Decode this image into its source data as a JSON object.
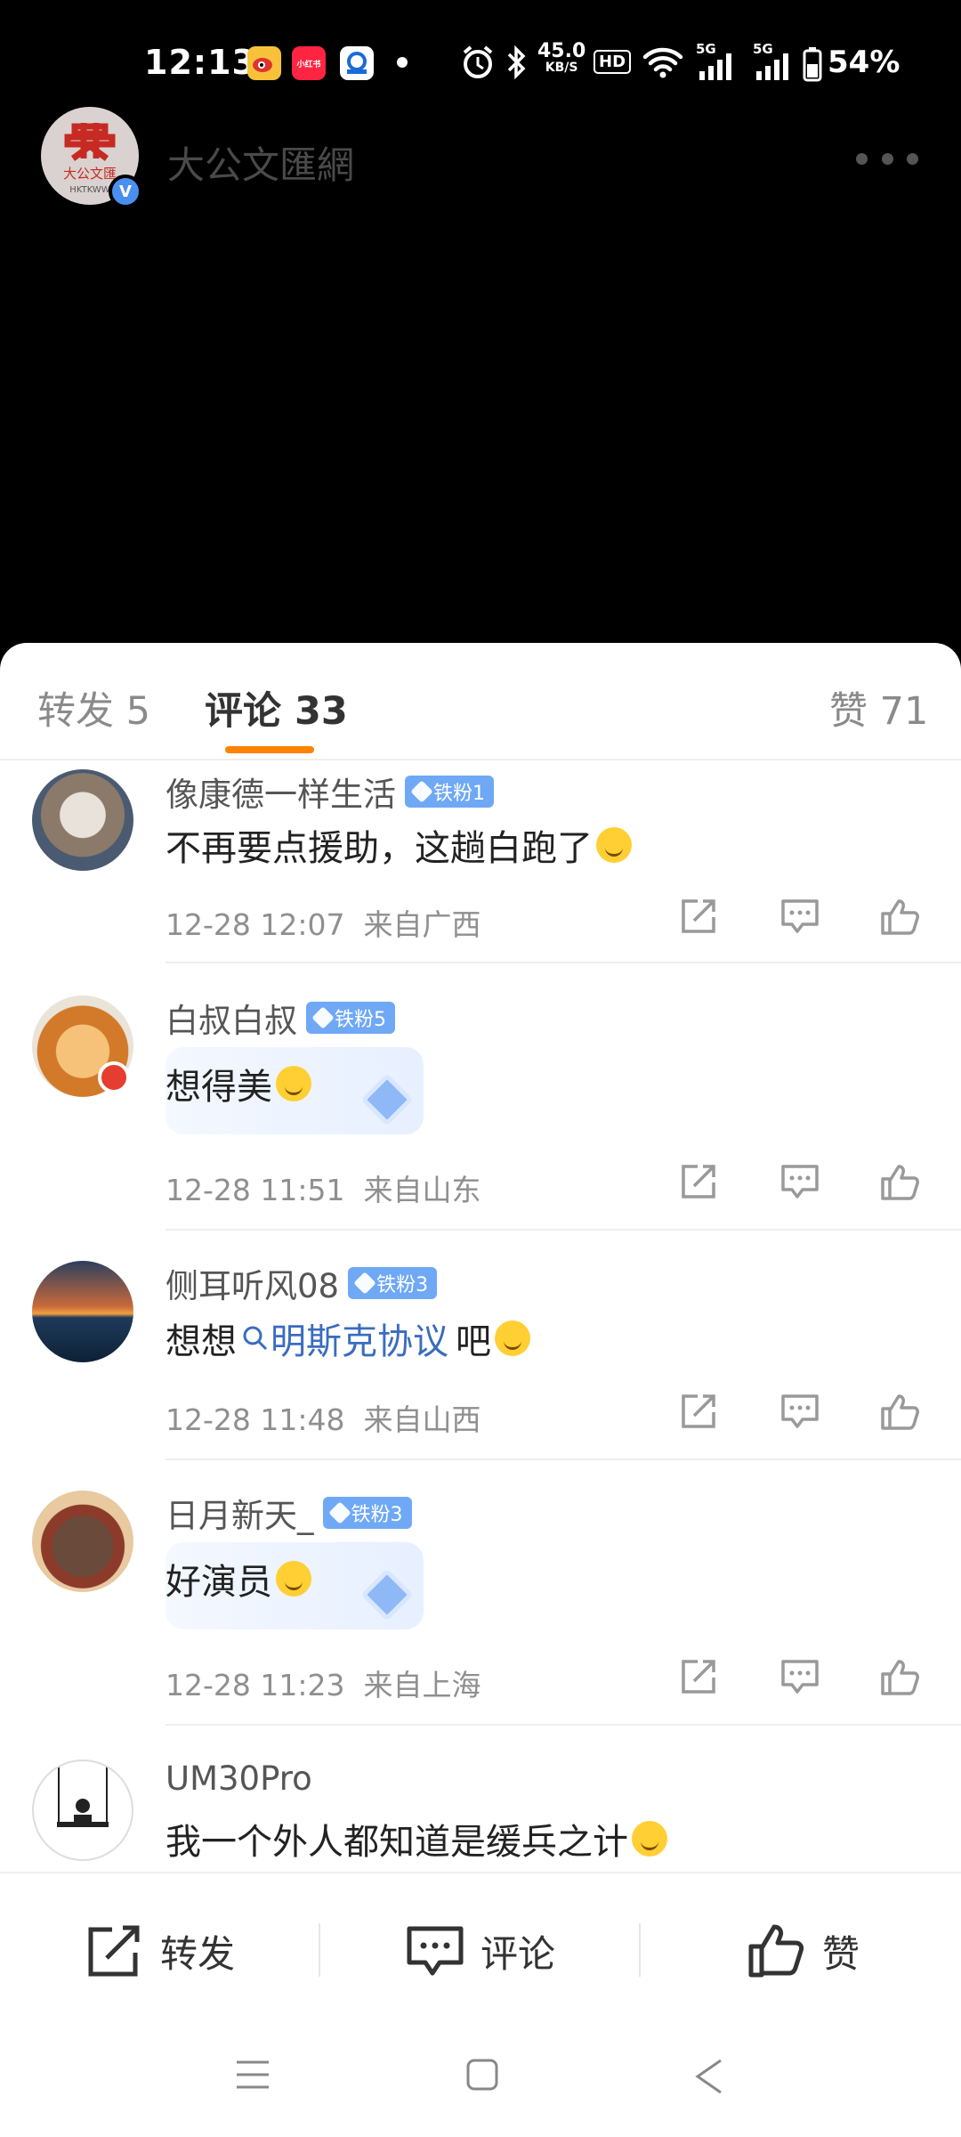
{
  "status_bar": {
    "time": "12:13",
    "net_speed_value": "45.0",
    "net_speed_unit": "KB/S",
    "hd": "HD",
    "signal1": "5G",
    "signal2": "5G",
    "battery": "54%",
    "apps": [
      "weibo-icon",
      "xiaohongshu-icon",
      "app-icon"
    ]
  },
  "header": {
    "account_name": "大公文匯網",
    "logo_text": "大公文匯",
    "logo_sub": "HKTKWW",
    "verified_mark": "V"
  },
  "tabs": {
    "repost": "转发 5",
    "comments": "评论 33",
    "likes": "赞 71"
  },
  "comments": [
    {
      "name": "像康德一样生活",
      "badge": "铁粉1",
      "text": "不再要点援助，这趟白跑了",
      "emoji": "laughing-emoji",
      "time": "12-28 12:07",
      "location": "来自广西",
      "avatar_colors": [
        "#8b7a6a",
        "#e8e2da"
      ]
    },
    {
      "name": "白叔白叔",
      "badge": "铁粉5",
      "text": "想得美",
      "emoji": "smile-emoji",
      "time": "12-28 11:51",
      "location": "来自山东",
      "avatar_colors": [
        "#d27a2a",
        "#f6c27a"
      ]
    },
    {
      "name": "侧耳听风08",
      "badge": "铁粉3",
      "text_before": "想想",
      "link": "明斯克协议",
      "text_after": "吧",
      "emoji": "crying-laughing-emoji",
      "time": "12-28 11:48",
      "location": "来自山西",
      "avatar_colors": [
        "#1e3a5a",
        "#f0a040"
      ]
    },
    {
      "name": "日月新天_",
      "badge": "铁粉3",
      "text": "好演员",
      "emoji": "thumbs-up-emoji",
      "time": "12-28 11:23",
      "location": "来自上海",
      "avatar_colors": [
        "#6a4a3a",
        "#e8c9a0"
      ]
    },
    {
      "name": "UM30Pro",
      "text": "我一个外人都知道是缓兵之计",
      "emoji": "sweat-emoji"
    }
  ],
  "bottom_bar": {
    "repost": "转发",
    "comment": "评论",
    "like": "赞"
  }
}
